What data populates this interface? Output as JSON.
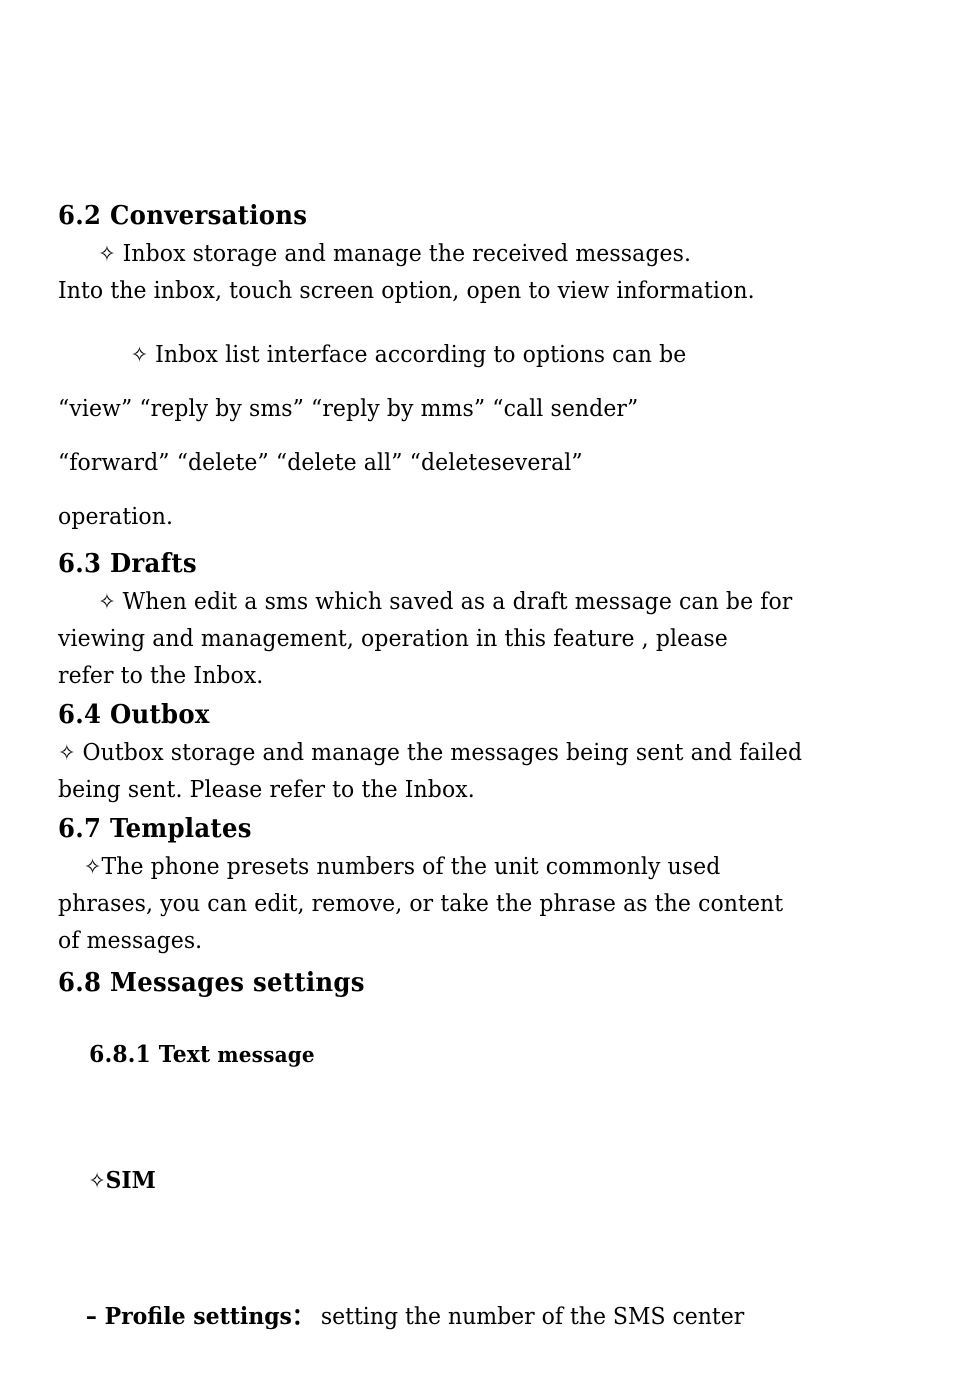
{
  "document": {
    "page_background": "#ffffff",
    "text_color": "#000000",
    "bullet_glyph": "✧",
    "bullet_name": "white-four-pointed-star"
  },
  "sections": [
    {
      "id": "6.2",
      "heading": "6.2 Conversations",
      "paragraphs": [
        {
          "id": "p-6-2-a",
          "lines": [
            "✧ Inbox storage and manage the received messages.",
            "Into the inbox, touch screen option, open to view information."
          ],
          "text": "✧ Inbox storage and manage the received messages. Into the inbox, touch screen option, open to view information."
        },
        {
          "id": "p-6-2-b",
          "lines": [
            "✧ Inbox list interface according to options can be",
            "“view” “reply by sms” “reply by mms” “call sender”",
            "“forward” “delete” “delete all” “deleteseveral”",
            "operation."
          ],
          "text": "✧ Inbox list interface according to options can be “view” “reply by sms” “reply by mms” “call sender” “forward” “delete” “delete all” “deleteseveral” operation."
        }
      ]
    },
    {
      "id": "6.3",
      "heading": "6.3 Drafts",
      "paragraphs": [
        {
          "id": "p-6-3-a",
          "lines": [
            "✧ When edit a sms which saved as a draft message can be for",
            "viewing and management, operation in this feature , please",
            "refer to the Inbox."
          ],
          "text": "✧ When edit a sms which saved as a draft message can be for viewing and management, operation in this feature , please refer to the Inbox."
        }
      ]
    },
    {
      "id": "6.4",
      "heading": "6.4 Outbox",
      "paragraphs": [
        {
          "id": "p-6-4-a",
          "lines": [
            "✧ Outbox storage and manage the messages being sent and failed",
            "being sent. Please refer to the Inbox."
          ],
          "text": "✧ Outbox storage and manage the messages being sent and failed being sent. Please refer to the Inbox."
        }
      ]
    },
    {
      "id": "6.7",
      "heading": "6.7 Templates",
      "paragraphs": [
        {
          "id": "p-6-7-a",
          "lines": [
            "✧The phone presets numbers of the unit commonly used",
            "phrases, you can edit, remove, or take the phrase as the content",
            "of messages."
          ],
          "text": "✧The phone presets numbers of the unit commonly used phrases, you can edit, remove, or take the phrase as the content of messages."
        }
      ]
    },
    {
      "id": "6.8",
      "heading": "6.8 Messages settings",
      "subheading": "6.8.1 Text message",
      "subheading_bold_part": "6.8.1 Text",
      "subheading_light_part": " message",
      "sim_label": "✧SIM",
      "items": [
        {
          "id": "profile-settings",
          "dash": "–",
          "term": "Profile settings",
          "colon": "：",
          "description": "setting the number of the SMS center"
        }
      ]
    }
  ],
  "body_runs": {
    "s62a_line1_pre": "✧ ",
    "s62a_line1": "Inbox storage and manage the received messages.",
    "s62a_line2": "Into the inbox, touch screen option, open to view information.",
    "s62b_star": "✧ ",
    "s62b_l1": "Inbox  list  interface  according  to  options  can  be",
    "s62b_l2": "“view”  “reply by sms”  “reply by mms”  “call sender”",
    "s62b_l3": "“forward”   “delete”   “delete  all”   “deleteseveral”",
    "s62b_l4": "operation.",
    "s63_star": "✧ ",
    "s63_l1": "When edit a sms which saved as a draft message can be for",
    "s63_l2": "viewing and management,  operation in this  feature , please",
    "s63_l3": "refer to the Inbox.",
    "s64_star": "✧ ",
    "s64_l1": "Outbox storage and manage the messages being sent and failed",
    "s64_l2": "being sent. Please refer to the Inbox.",
    "s67_star": "✧",
    "s67_l1": "The  phone  presets  numbers  of  the  unit  commonly  used",
    "s67_l2": "phrases, you can edit, remove,  or take the phrase as the content",
    "s67_l3": "of messages.",
    "sim_star": "✧",
    "sim_text": "SIM",
    "profile_dash": "– ",
    "profile_term": "Profile settings",
    "profile_colon": "：",
    "profile_desc": " setting the number of the SMS center"
  }
}
